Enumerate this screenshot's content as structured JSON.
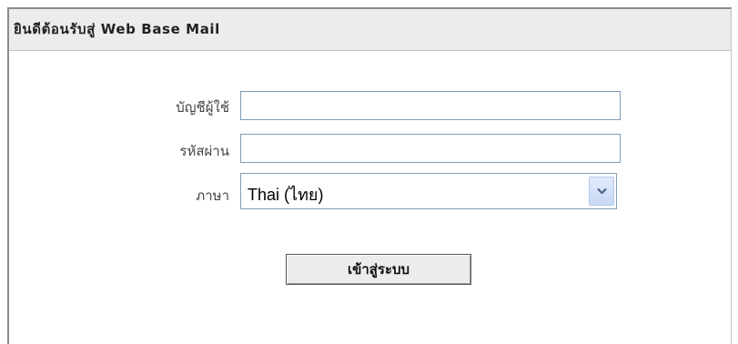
{
  "window": {
    "title": "ยินดีต้อนรับสู่ Web Base Mail"
  },
  "form": {
    "username_label": "บัญชีผู้ใช้",
    "username_value": "",
    "password_label": "รหัสผ่าน",
    "password_value": "",
    "language_label": "ภาษา",
    "language_selected": "Thai (ไทย)",
    "login_button": "เข้าสู่ระบบ"
  },
  "icons": {
    "dropdown": "chevron-down-icon"
  },
  "colors": {
    "titlebar_bg": "#ececec",
    "input_border": "#7f9db9",
    "arrow_button": "#c6d7f5"
  }
}
